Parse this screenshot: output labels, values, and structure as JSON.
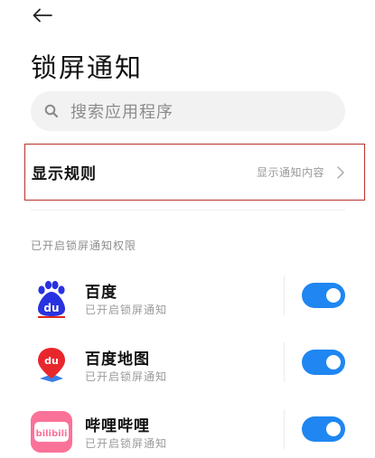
{
  "header": {
    "back_icon": "arrow-left-icon",
    "title": "锁屏通知"
  },
  "search": {
    "icon": "search-icon",
    "placeholder": "搜索应用程序"
  },
  "rule": {
    "title": "显示规则",
    "value": "显示通知内容",
    "chevron_icon": "chevron-right-icon"
  },
  "section": {
    "header": "已开启锁屏通知权限"
  },
  "apps": [
    {
      "name": "百度",
      "status": "已开启锁屏通知",
      "icon": "baidu-icon",
      "toggle_on": true
    },
    {
      "name": "百度地图",
      "status": "已开启锁屏通知",
      "icon": "baidu-map-icon",
      "toggle_on": true
    },
    {
      "name": "哔哩哔哩",
      "status": "已开启锁屏通知",
      "icon": "bilibili-icon",
      "toggle_on": true
    }
  ],
  "colors": {
    "accent": "#1f86f2",
    "highlight_border": "#b8322c",
    "secondary_text": "#9a9a9a"
  }
}
